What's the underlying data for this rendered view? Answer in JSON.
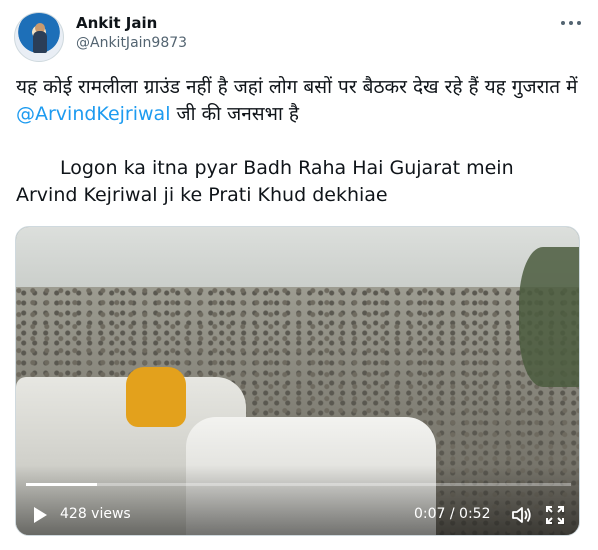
{
  "author": {
    "name": "Ankit Jain",
    "handle": "@AnkitJain9873"
  },
  "tweet": {
    "hindi_before": "यह कोई रामलीला ग्राउंड नहीं है जहां लोग बसों पर बैठकर देख रहे हैं यह गुजरात में ",
    "mention": "@ArvindKejriwal",
    "hindi_after": " जी की जनसभा है",
    "english_line1": "Logon ka itna pyar Badh Raha Hai Gujarat mein",
    "english_line2": "Arvind Kejriwal ji ke Prati Khud dekhiae"
  },
  "video": {
    "views": "428 views",
    "time": "0:07 / 0:52",
    "progress_fraction": 0.13,
    "icons": [
      "play-icon",
      "volume-icon",
      "fullscreen-icon",
      "more-icon"
    ]
  },
  "colors": {
    "link": "#1d9bf0",
    "secondary_text": "#536471"
  }
}
